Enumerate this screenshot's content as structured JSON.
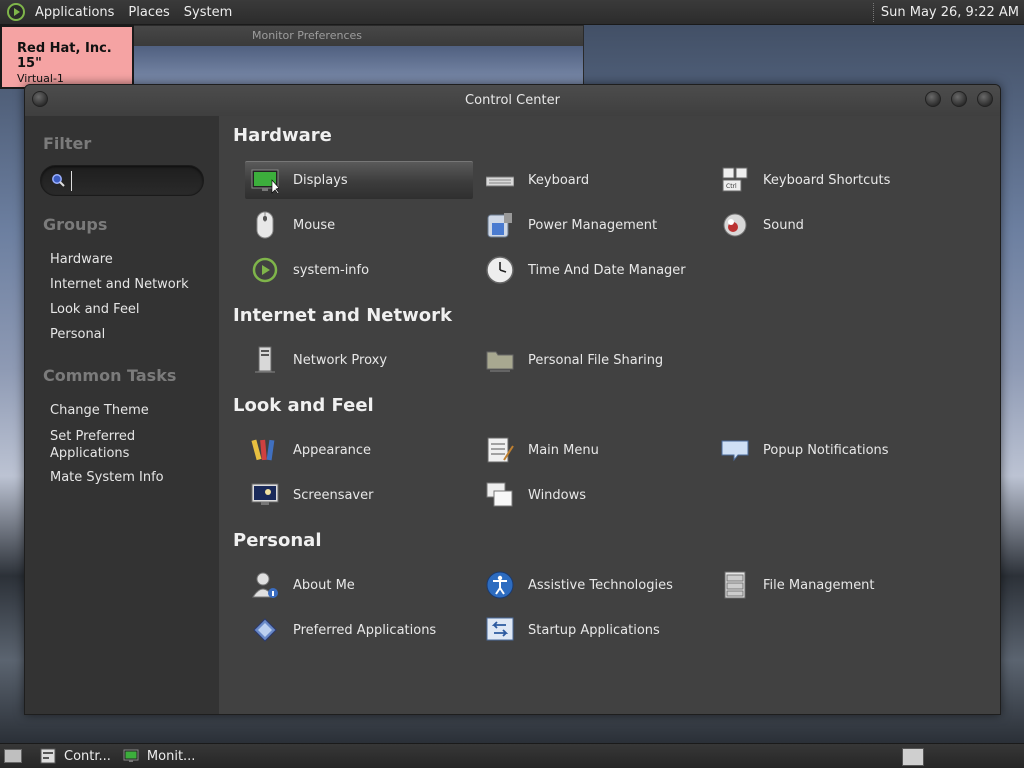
{
  "top_panel": {
    "menus": [
      "Applications",
      "Places",
      "System"
    ],
    "clock": "Sun May 26,  9:22 AM"
  },
  "background_window": {
    "title": "Monitor Preferences",
    "monitor_label": {
      "name": "Red Hat, Inc. 15\"",
      "sub": "Virtual-1"
    }
  },
  "window": {
    "title": "Control Center"
  },
  "sidebar": {
    "filter_heading": "Filter",
    "search_value": "",
    "groups_heading": "Groups",
    "groups": [
      "Hardware",
      "Internet and Network",
      "Look and Feel",
      "Personal"
    ],
    "common_tasks_heading": "Common Tasks",
    "common_tasks": [
      "Change Theme",
      "Set Preferred Applications",
      "Mate System Info"
    ]
  },
  "sections": [
    {
      "title": "Hardware",
      "items": [
        {
          "label": "Displays",
          "icon": "display-icon",
          "selected": true
        },
        {
          "label": "Keyboard",
          "icon": "keyboard-icon"
        },
        {
          "label": "Keyboard Shortcuts",
          "icon": "keyboard-shortcuts-icon"
        },
        {
          "label": "Mouse",
          "icon": "mouse-icon"
        },
        {
          "label": "Power Management",
          "icon": "power-icon"
        },
        {
          "label": "Sound",
          "icon": "sound-icon"
        },
        {
          "label": "system-info",
          "icon": "system-info-icon"
        },
        {
          "label": "Time And Date Manager",
          "icon": "clock-icon"
        }
      ]
    },
    {
      "title": "Internet and Network",
      "items": [
        {
          "label": "Network Proxy",
          "icon": "network-proxy-icon"
        },
        {
          "label": "Personal File Sharing",
          "icon": "folder-share-icon"
        }
      ]
    },
    {
      "title": "Look and Feel",
      "items": [
        {
          "label": "Appearance",
          "icon": "appearance-icon"
        },
        {
          "label": "Main Menu",
          "icon": "main-menu-icon"
        },
        {
          "label": "Popup Notifications",
          "icon": "notification-icon"
        },
        {
          "label": "Screensaver",
          "icon": "screensaver-icon"
        },
        {
          "label": "Windows",
          "icon": "windows-icon"
        }
      ]
    },
    {
      "title": "Personal",
      "items": [
        {
          "label": "About Me",
          "icon": "about-me-icon"
        },
        {
          "label": "Assistive Technologies",
          "icon": "accessibility-icon"
        },
        {
          "label": "File Management",
          "icon": "file-cabinet-icon"
        },
        {
          "label": "Preferred Applications",
          "icon": "preferred-apps-icon"
        },
        {
          "label": "Startup Applications",
          "icon": "startup-icon"
        }
      ]
    }
  ],
  "taskbar": {
    "tasks": [
      "Contr...",
      "Monit..."
    ]
  },
  "colors": {
    "panel": "#2c2c2c",
    "window_bg": "#414141",
    "sidebar_bg": "#333333",
    "monitor_label_bg": "#f5a3a3",
    "accent_green": "#7fb54a"
  }
}
